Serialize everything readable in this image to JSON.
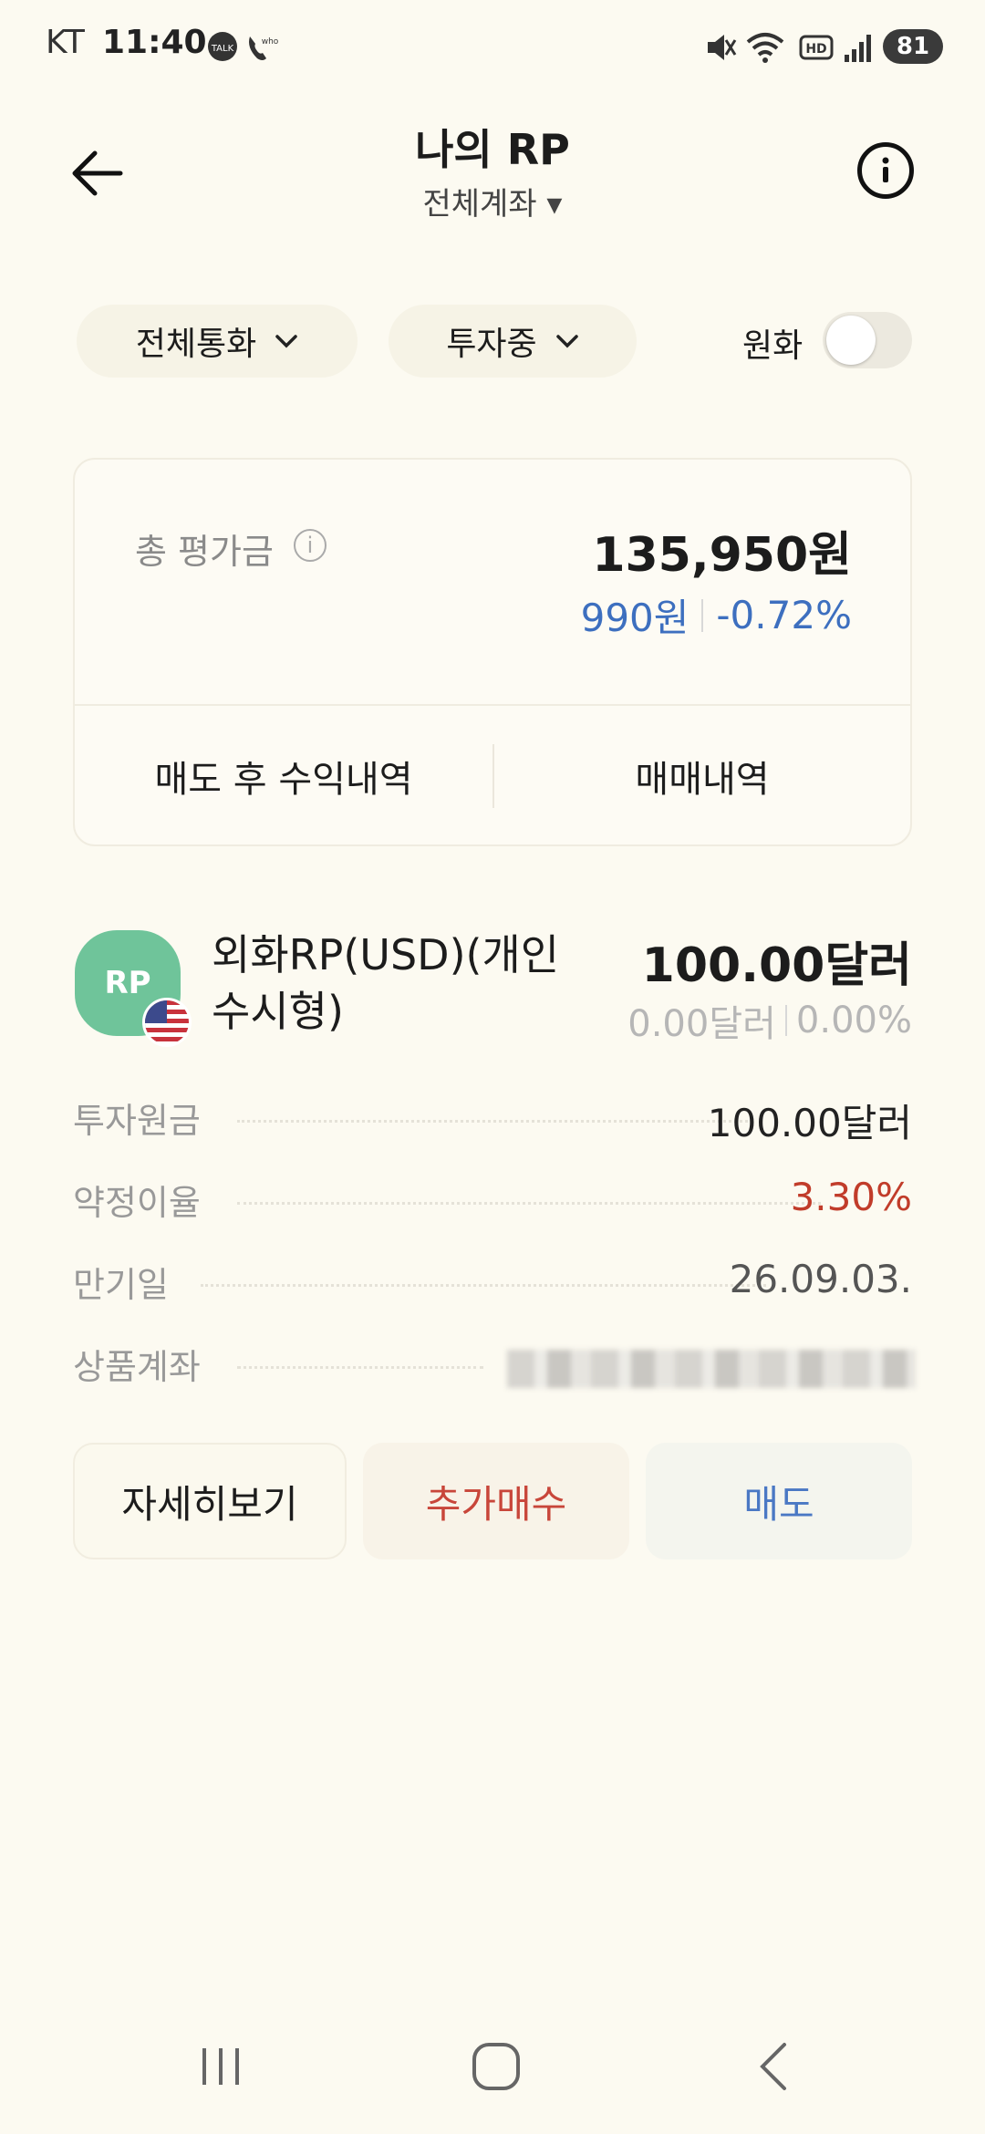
{
  "status_bar": {
    "carrier": "KT",
    "time": "11:40",
    "battery": "81"
  },
  "header": {
    "title": "나의 RP",
    "account_selector": "전체계좌 ▾"
  },
  "filters": {
    "currency": "전체통화",
    "status": "투자중",
    "krw_toggle_label": "원화",
    "krw_toggle_on": false
  },
  "summary": {
    "total_label": "총 평가금",
    "total_value": "135,950원",
    "change_amount": "990원",
    "change_rate": "-0.72%",
    "profit_history_button": "매도 후 수익내역",
    "trade_history_button": "매매내역"
  },
  "product": {
    "logo_text": "RP",
    "name": "외화RP(USD)(개인수시형)",
    "value": "100.00달러",
    "change_amount": "0.00달러",
    "change_rate": "0.00%",
    "details": [
      {
        "label": "투자원금",
        "value": "100.00달러"
      },
      {
        "label": "약정이율",
        "value": "3.30%"
      },
      {
        "label": "만기일",
        "value": "26.09.03."
      },
      {
        "label": "상품계좌",
        "value": ""
      }
    ]
  },
  "actions": {
    "detail": "자세히보기",
    "buy_more": "추가매수",
    "sell": "매도"
  },
  "colors": {
    "background": "#fcfaf1",
    "negative_blue": "#3d6fbf",
    "rate_red": "#c13c2a",
    "rp_green": "#6fc49a"
  }
}
